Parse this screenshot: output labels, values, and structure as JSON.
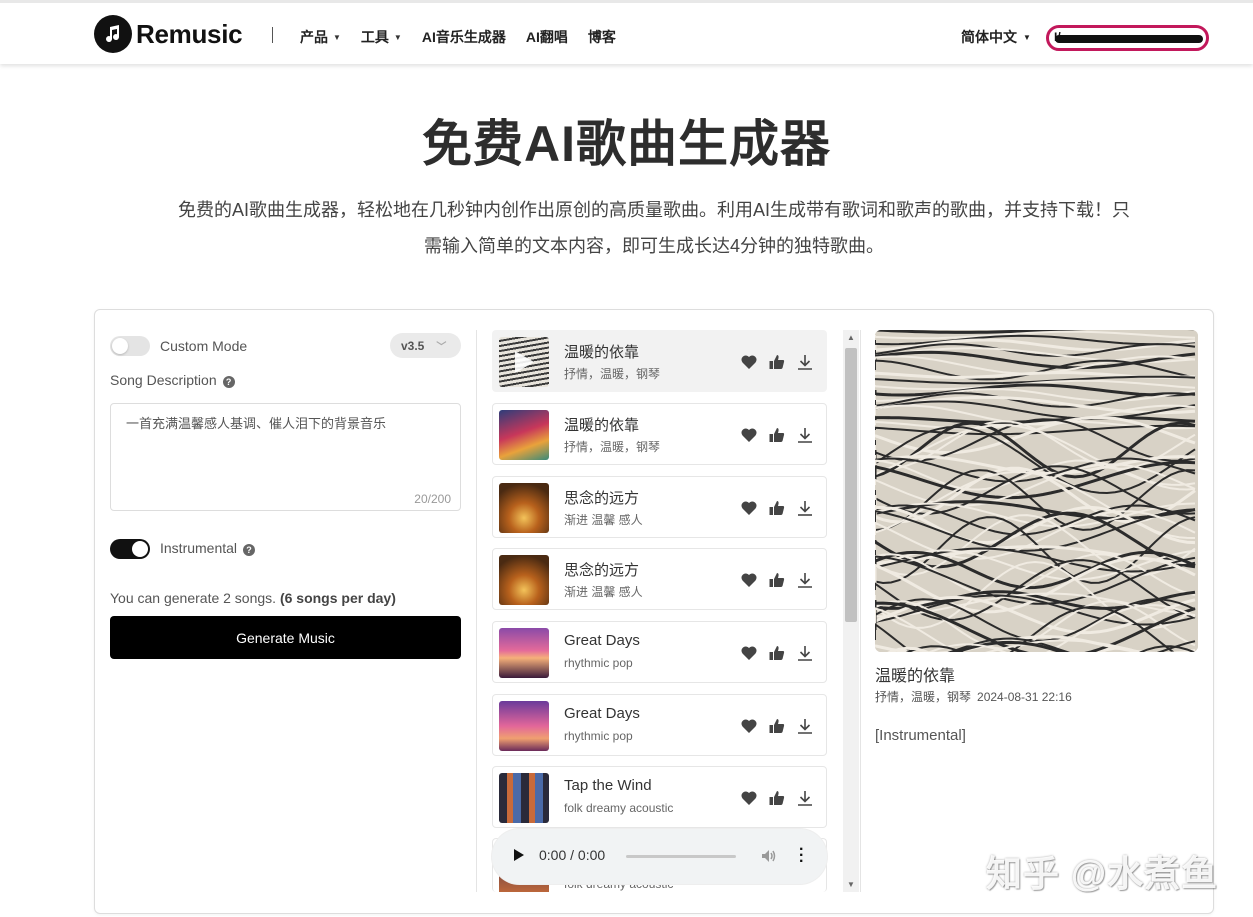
{
  "header": {
    "logo_text": "Remusic",
    "nav": [
      {
        "label": "产品",
        "has_dropdown": true
      },
      {
        "label": "工具",
        "has_dropdown": true
      },
      {
        "label": "AI音乐生成器",
        "has_dropdown": false
      },
      {
        "label": "AI翻唱",
        "has_dropdown": false
      },
      {
        "label": "博客",
        "has_dropdown": false
      }
    ],
    "language": "简体中文",
    "user_pill_text": "I/",
    "accent_color": "#c2185b"
  },
  "hero": {
    "title": "免费AI歌曲生成器",
    "description": "免费的AI歌曲生成器，轻松地在几秒钟内创作出原创的高质量歌曲。利用AI生成带有歌词和歌声的歌曲，并支持下载！只需输入简单的文本内容，即可生成长达4分钟的独特歌曲。"
  },
  "form": {
    "custom_mode_label": "Custom Mode",
    "custom_mode_on": false,
    "version": "v3.5",
    "song_description_label": "Song Description",
    "song_description_value": "一首充满温馨感人基调、催人泪下的背景音乐",
    "char_counter": "20/200",
    "instrumental_label": "Instrumental",
    "instrumental_on": true,
    "quota_text": "You can generate 2 songs.",
    "quota_bold": "(6 songs per day)",
    "generate_button": "Generate Music"
  },
  "songs": [
    {
      "title": "温暖的依靠",
      "tags": "抒情，温暖，钢琴",
      "art": "waves",
      "active": true
    },
    {
      "title": "温暖的依靠",
      "tags": "抒情，温暖，钢琴",
      "art": "colorful",
      "active": false
    },
    {
      "title": "思念的远方",
      "tags": "渐进 温馨 感人",
      "art": "autumn",
      "active": false
    },
    {
      "title": "思念的远方",
      "tags": "渐进 温馨 感人",
      "art": "autumn",
      "active": false
    },
    {
      "title": "Great Days",
      "tags": "rhythmic pop",
      "art": "sunset-tree",
      "active": false
    },
    {
      "title": "Great Days",
      "tags": "rhythmic pop",
      "art": "sunset-figure",
      "active": false
    },
    {
      "title": "Tap the Wind",
      "tags": "folk dreamy acoustic",
      "art": "collage",
      "active": false
    }
  ],
  "partial_song_tags": "folk dreamy acoustic",
  "player": {
    "time": "0:00 / 0:00"
  },
  "detail": {
    "title": "温暖的依靠",
    "tags": "抒情，温暖，钢琴",
    "datetime": "2024-08-31 22:16",
    "lyrics": "[Instrumental]"
  },
  "watermark": "知乎 @水煮鱼"
}
